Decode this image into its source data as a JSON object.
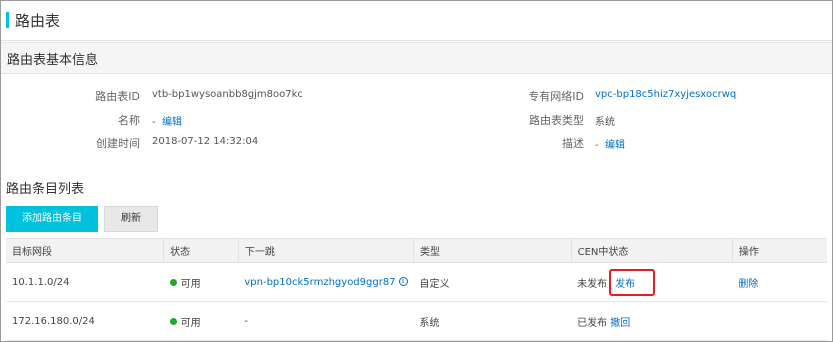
{
  "page": {
    "title": "路由表"
  },
  "basic_info": {
    "section_title": "路由表基本信息",
    "route_table_id": {
      "label": "路由表ID",
      "value": "vtb-bp1wysoanbb8gjm8oo7kc"
    },
    "name": {
      "label": "名称",
      "value": "-",
      "edit": "编辑"
    },
    "created": {
      "label": "创建时间",
      "value": "2018-07-12 14:32:04"
    },
    "vpc": {
      "label": "专有网络ID",
      "value": "vpc-bp18c5hiz7xyjesxocrwq"
    },
    "type": {
      "label": "路由表类型",
      "value": "系统"
    },
    "description": {
      "label": "描述",
      "value": "-",
      "edit": "编辑"
    }
  },
  "entries": {
    "section_title": "路由条目列表",
    "add_button": "添加路由条目",
    "refresh_button": "刷新",
    "columns": [
      "目标网段",
      "状态",
      "下一跳",
      "类型",
      "CEN中状态",
      "操作"
    ],
    "rows": [
      {
        "cidr": "10.1.1.0/24",
        "status": "可用",
        "next_hop": "vpn-bp10ck5rmzhgyod9ggr87",
        "info_icon": "i",
        "type": "自定义",
        "cen_status": "未发布",
        "cen_action": "发布",
        "operation": "删除"
      },
      {
        "cidr": "172.16.180.0/24",
        "status": "可用",
        "next_hop": "-",
        "type": "系统",
        "cen_status": "已发布",
        "cen_action": "撤回",
        "operation": ""
      }
    ]
  },
  "colors": {
    "accent": "#00c1de",
    "link": "#0070cc",
    "status_ok": "#1ea82f",
    "highlight": "#e02020"
  }
}
